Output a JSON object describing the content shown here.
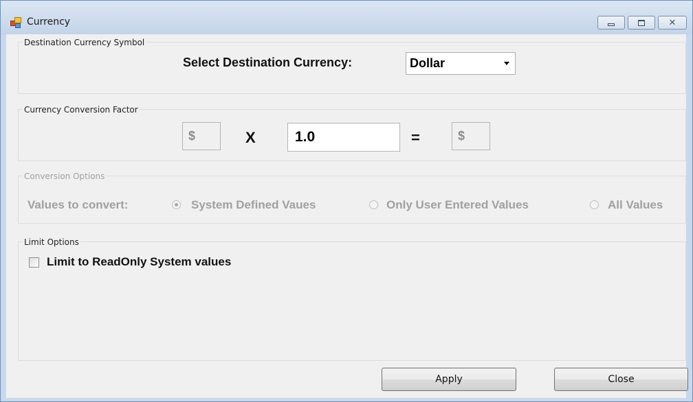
{
  "window": {
    "title": "Currency"
  },
  "groups": {
    "destination": {
      "title": "Destination Currency Symbol",
      "select_label": "Select Destination Currency:",
      "selected_currency": "Dollar"
    },
    "factor": {
      "title": "Currency Conversion Factor",
      "left_symbol": "$",
      "multiply_sign": "X",
      "factor_value": "1.0",
      "equals_sign": "=",
      "right_symbol": "$"
    },
    "conversion": {
      "title": "Conversion Options",
      "values_label": "Values to convert:",
      "options": [
        {
          "label": "System Defined Vaues",
          "checked": true
        },
        {
          "label": "Only User Entered Values",
          "checked": false
        },
        {
          "label": "All Values",
          "checked": false
        }
      ]
    },
    "limit": {
      "title": "Limit Options",
      "checkbox_label": "Limit to ReadOnly System values",
      "checked": false
    }
  },
  "buttons": {
    "apply": "Apply",
    "close": "Close"
  },
  "colors": {
    "window_frame": "#c9d8ea",
    "client_background": "#f0f0f0",
    "disabled_text": "#a0a0a0"
  }
}
